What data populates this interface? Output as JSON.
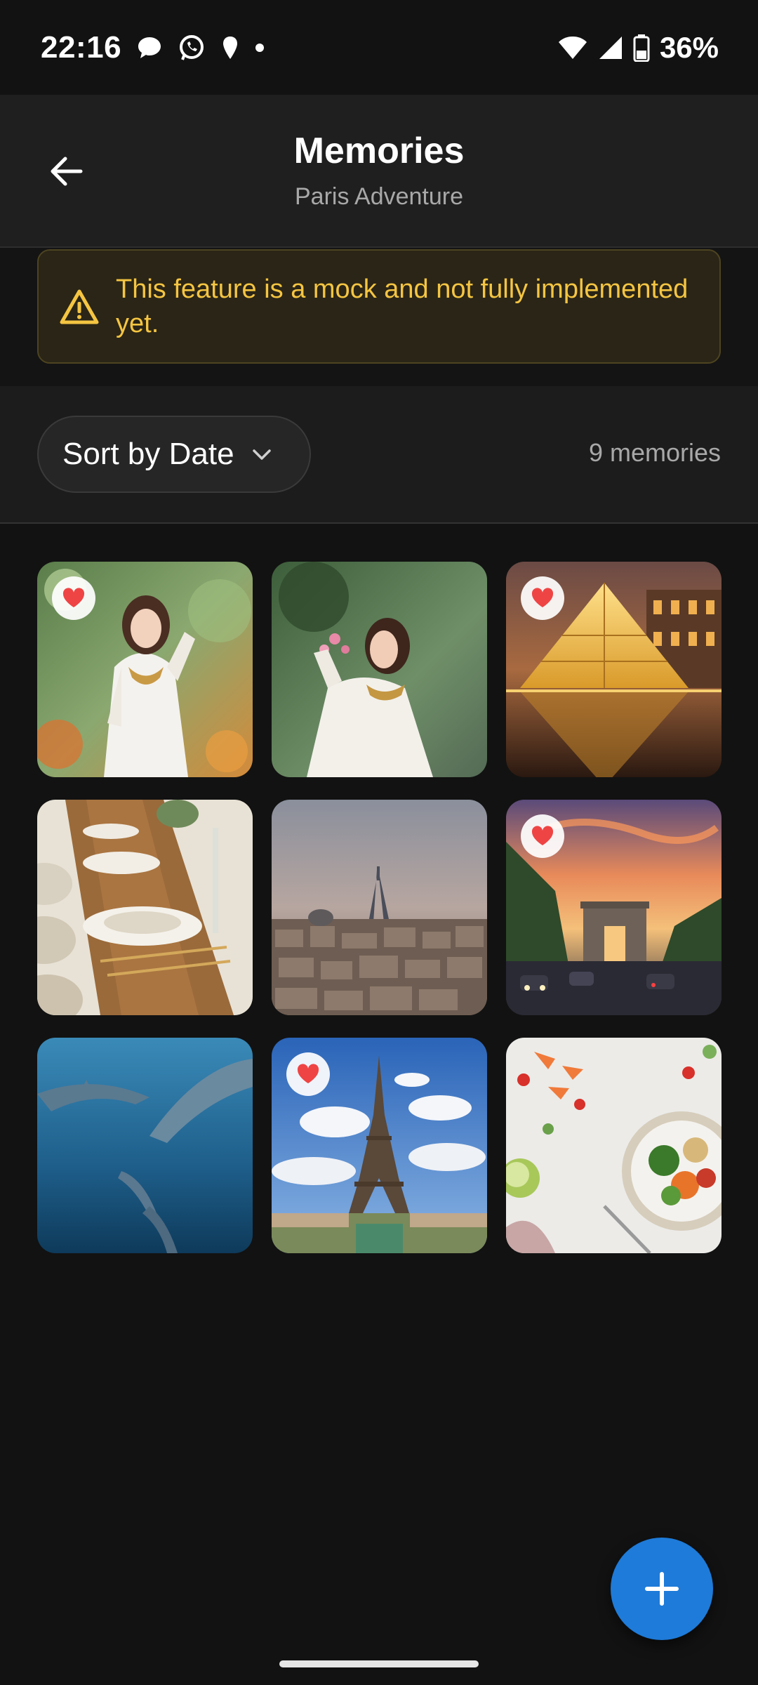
{
  "status_bar": {
    "time": "22:16",
    "battery": "36%",
    "icons": [
      "chat-bubble-icon",
      "whatsapp-icon",
      "location-pin-icon",
      "dot-icon",
      "wifi-icon",
      "signal-icon",
      "battery-icon"
    ]
  },
  "header": {
    "title": "Memories",
    "subtitle": "Paris Adventure",
    "back_icon": "arrow-left-icon"
  },
  "banner": {
    "text": "This feature is a mock and not fully implemented yet.",
    "icon": "warning-triangle-icon",
    "color": "#f5c542"
  },
  "toolbar": {
    "sort_label": "Sort by Date",
    "sort_icon": "chevron-down-icon",
    "count": "9 memories"
  },
  "memories": [
    {
      "subject": "woman in white ao dai among flowers",
      "favorite": true
    },
    {
      "subject": "woman in white ao dai holding flowers",
      "favorite": false
    },
    {
      "subject": "Louvre pyramid at night",
      "favorite": true
    },
    {
      "subject": "banquet dining table",
      "favorite": false
    },
    {
      "subject": "Paris skyline with Eiffel Tower",
      "favorite": false
    },
    {
      "subject": "Arc de Triomphe at sunset",
      "favorite": true
    },
    {
      "subject": "dolphins underwater",
      "favorite": false
    },
    {
      "subject": "Eiffel Tower blue sky",
      "favorite": true
    },
    {
      "subject": "healthy food bowl",
      "favorite": false
    }
  ],
  "fab": {
    "icon": "plus-icon",
    "color": "#1e7bd9"
  }
}
